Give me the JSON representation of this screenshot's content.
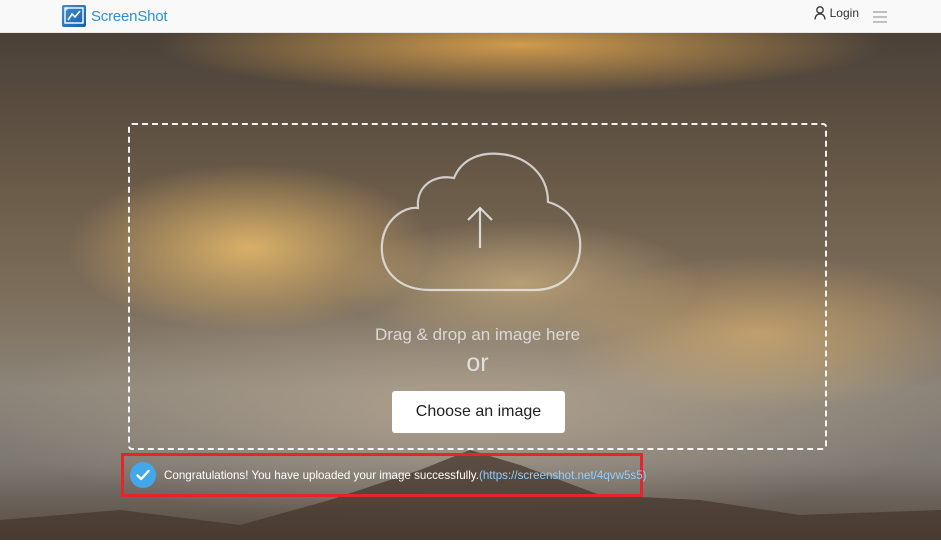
{
  "header": {
    "brand": "ScreenShot",
    "login_label": "Login",
    "icons": {
      "logo": "screenshot-logo-icon",
      "user": "user-icon",
      "menu": "hamburger-menu-icon"
    }
  },
  "upload": {
    "drop_text": "Drag & drop an image here",
    "or_text": "or",
    "choose_button": "Choose an image",
    "cloud_icon": "cloud-upload-icon"
  },
  "notification": {
    "message": "Congratulations! You have uploaded your image successfully.",
    "link_text": "(https://screenshot.net/4qvw5s5)",
    "icon": "checkmark-circle-icon",
    "highlight_color": "#e2262b",
    "check_color": "#41a8ec"
  },
  "colors": {
    "brand": "#2d8fd6",
    "header_bg": "#f9f9f9"
  }
}
